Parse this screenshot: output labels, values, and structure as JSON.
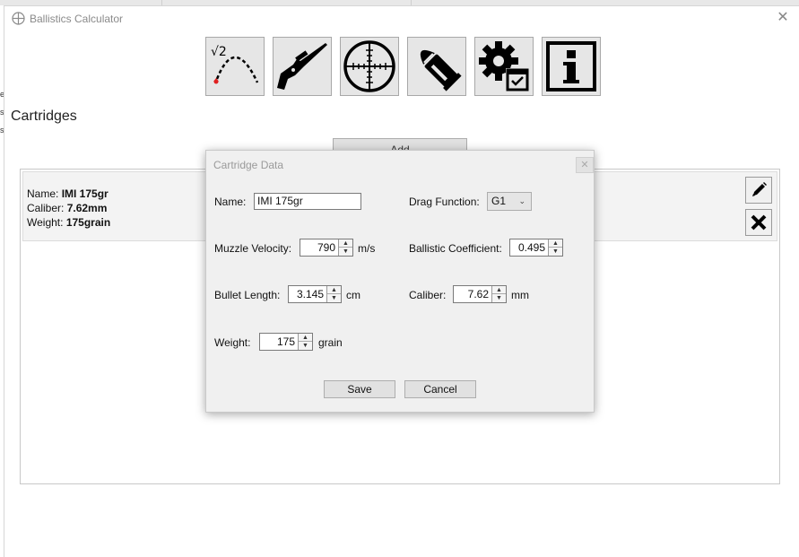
{
  "window": {
    "title": "Ballistics Calculator"
  },
  "toolbar": {
    "buttons": [
      {
        "name": "trajectory",
        "icon": "trajectory-icon"
      },
      {
        "name": "rifle",
        "icon": "rifle-icon"
      },
      {
        "name": "scope",
        "icon": "crosshair-icon"
      },
      {
        "name": "cartridges",
        "icon": "cartridge-icon"
      },
      {
        "name": "settings",
        "icon": "gear-icon"
      },
      {
        "name": "info",
        "icon": "info-icon"
      }
    ]
  },
  "page": {
    "title": "Cartridges",
    "add_label": "Add"
  },
  "cartridge_list": [
    {
      "name_label": "Name:",
      "name": "IMI 175gr",
      "caliber_label": "Caliber:",
      "caliber": "7.62mm",
      "weight_label": "Weight:",
      "weight": "175grain"
    }
  ],
  "dialog": {
    "title": "Cartridge Data",
    "name_label": "Name:",
    "name_value": "IMI 175gr",
    "drag_label": "Drag Function:",
    "drag_value": "G1",
    "muzzle_label": "Muzzle Velocity:",
    "muzzle_value": "790",
    "muzzle_unit": "m/s",
    "bc_label": "Ballistic Coefficient:",
    "bc_value": "0.495",
    "length_label": "Bullet Length:",
    "length_value": "3.145",
    "length_unit": "cm",
    "caliber_label": "Caliber:",
    "caliber_value": "7.62",
    "caliber_unit": "mm",
    "weight_label": "Weight:",
    "weight_value": "175",
    "weight_unit": "grain",
    "save_label": "Save",
    "cancel_label": "Cancel"
  }
}
